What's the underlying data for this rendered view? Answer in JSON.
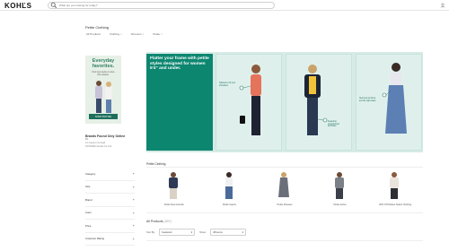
{
  "header": {
    "logo": "KOHĽS",
    "search_placeholder": "What are you looking for today?"
  },
  "page": {
    "title": "Petite Clothing",
    "filters": [
      {
        "label": "All Products"
      },
      {
        "label": "Clothing"
      },
      {
        "label": "Womens"
      },
      {
        "label": "Petite"
      }
    ]
  },
  "promo": {
    "title_line1": "Everyday",
    "title_line2": "favorites.",
    "sub_line1": "Find new styles to love",
    "sub_line2": "this season.",
    "cta": "SHOP PETITES"
  },
  "brand": {
    "title": "Brands Found Only Online",
    "lines": [
      "Bit",
      "LC Lauren Conrad",
      "SONOMA Goods for Life"
    ]
  },
  "facets": [
    {
      "label": "Category"
    },
    {
      "label": "Size"
    },
    {
      "label": "Brand"
    },
    {
      "label": "Color"
    },
    {
      "label": "Price"
    },
    {
      "label": "Customer Rating"
    }
  ],
  "hero": {
    "headline": "Flatter your frame with petite styles designed for women 5'4\" and under.",
    "callouts": [
      "Tailored to fit your shoulders",
      "Featuring proportioned armholes",
      "Hemmed to fall at just the right waist"
    ]
  },
  "petite_section": {
    "title": "Petite Clothing",
    "cards": [
      {
        "label": "Petite New Arrivals"
      },
      {
        "label": "Petite Capris"
      },
      {
        "label": "Petite Dresses"
      },
      {
        "label": "Petite Active"
      },
      {
        "label": "20% Off Petites Select Clothing"
      }
    ]
  },
  "products": {
    "title": "All Products",
    "count": "(307)",
    "sort_label": "Sort By",
    "sort_value": "Featured",
    "show_label": "Show",
    "show_value": "48 items"
  },
  "colors": {
    "brand_green": "#0d8670",
    "hero_bg": "#dff0ec"
  }
}
